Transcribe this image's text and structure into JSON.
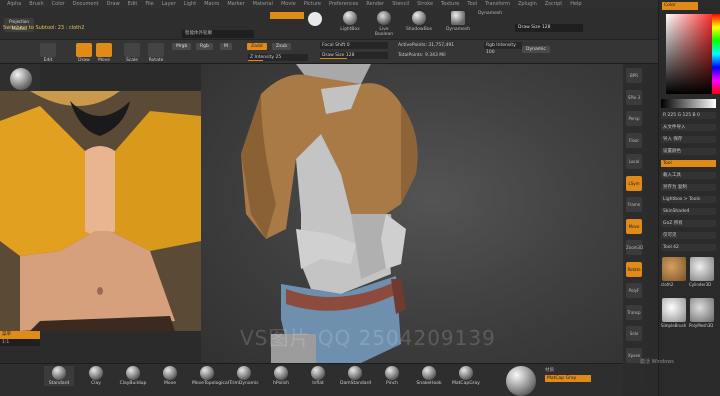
{
  "menubar": [
    "Alpha",
    "Brush",
    "Color",
    "Document",
    "Draw",
    "Edit",
    "File",
    "Layer",
    "Light",
    "Macro",
    "Marker",
    "Material",
    "Movie",
    "Picture",
    "Preferences",
    "Render",
    "Stencil",
    "Stroke",
    "Texture",
    "Tool",
    "Transform",
    "Zplugin",
    "Zscript",
    "Help"
  ],
  "topbar": {
    "status": "Switching to Subtool: 23 : cloth2",
    "projection_master": "Projection Master",
    "dropdown_label": "智能体外轮廓",
    "tools": [
      {
        "label": "LightBox"
      },
      {
        "label": "Live Boolean"
      },
      {
        "label": "ShadowBox"
      },
      {
        "label": "Dynamesh"
      }
    ],
    "draw_size": "Draw Size 128"
  },
  "toolbar2": {
    "buttons": [
      "Edit",
      "Draw",
      "Move",
      "Scale",
      "Rotate"
    ],
    "mrgb": "Mrgb",
    "rgb": "Rgb",
    "m": "M",
    "zadd": "Zadd",
    "zsub": "Zsub",
    "focal": "Focal Shift 0",
    "z_intensity": "Z Intensity 25",
    "active_points": "ActivePoints: 31,757,491",
    "total_points": "TotalPoints: 9.343 Mil",
    "dynamic": "Dynamic",
    "rgb_intensity": "Rgb Intensity 100",
    "draw_size2": "Draw Size 128"
  },
  "reference": {
    "note": "菜单",
    "note2": "1:1"
  },
  "watermark": "VS图片 QQ 2504209139",
  "right_shelf": [
    "BPR",
    "SPix 3",
    "Persp",
    "Floor",
    "Local",
    "LSym",
    "Frame",
    "Move",
    "Zoom3D",
    "Rotate",
    "PolyF",
    "Transp",
    "Solo",
    "Xpose"
  ],
  "right_panel": {
    "title": "Color",
    "rows": [
      "R 225 G 125 B 0",
      "从文件导入",
      "导入 保存",
      "设置颜色",
      "Tool",
      "载入工具",
      "另存为 复制",
      "Lightbox > Tools",
      "SkinShade4",
      "GoZ  所有",
      "仅可见",
      "Tool 42"
    ],
    "thumb_labels": [
      "cloth2",
      "Cylinder3D",
      "SimpleBrush",
      "PolyMesh3D"
    ]
  },
  "brushes": [
    {
      "label": "Standard"
    },
    {
      "label": "Clay"
    },
    {
      "label": "ClayBuildup"
    },
    {
      "label": "Move"
    },
    {
      "label": "MoveTopological"
    },
    {
      "label": "TrimDynamic"
    },
    {
      "label": "hPolish"
    },
    {
      "label": "Inflat"
    },
    {
      "label": "DamStandard"
    },
    {
      "label": "Pinch"
    },
    {
      "label": "SnakeHook"
    },
    {
      "label": "MatCapGray"
    }
  ],
  "material": {
    "label": "MatCap Gray",
    "sub": "材质"
  },
  "windows_text": "激活 Windows"
}
